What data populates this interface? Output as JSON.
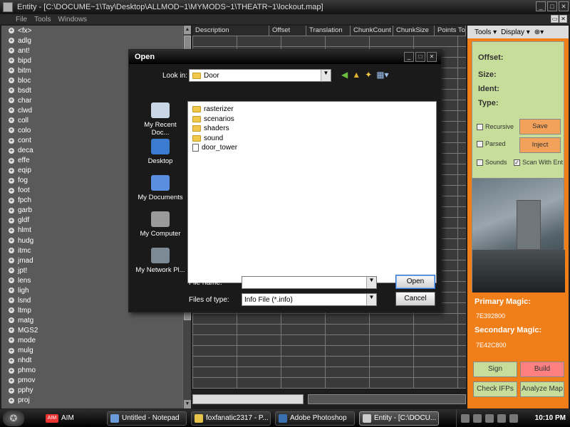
{
  "window": {
    "title": "Entity - [C:\\DOCUME~1\\Tay\\Desktop\\ALLMOD~1\\MYMODS~1\\THEATR~1\\lockout.map]",
    "menu": [
      "File",
      "Tools",
      "Windows"
    ]
  },
  "tree": {
    "items": [
      "<fx>",
      "adlg",
      "ant!",
      "bipd",
      "bitm",
      "bloc",
      "bsdt",
      "char",
      "clwd",
      "coll",
      "colo",
      "cont",
      "deca",
      "effe",
      "eqip",
      "fog",
      "foot",
      "fpch",
      "garb",
      "gldf",
      "hlmt",
      "hudg",
      "itmc",
      "jmad",
      "jpt!",
      "lens",
      "ligh",
      "lsnd",
      "ltmp",
      "matg",
      "MGS2",
      "mode",
      "mulg",
      "nhdt",
      "phmo",
      "pmov",
      "pphy",
      "proj"
    ]
  },
  "grid": {
    "columns": [
      "Description",
      "Offset",
      "Translation",
      "ChunkCount",
      "ChunkSize",
      "Points To"
    ]
  },
  "right_panel": {
    "toolbar": {
      "tools": "Tools",
      "display": "Display"
    },
    "info_labels": {
      "offset": "Offset:",
      "size": "Size:",
      "ident": "Ident:",
      "type": "Type:"
    },
    "checks": {
      "recursive": "Recursive",
      "parsed": "Parsed",
      "sounds": "Sounds",
      "scan_with_ent": "Scan With Ent"
    },
    "buttons": {
      "save": "Save",
      "inject": "Inject",
      "sign": "Sign",
      "build": "Build",
      "check_ifps": "Check IFPs",
      "analyze_map": "Analyze Map"
    },
    "primary_magic_label": "Primary Magic:",
    "primary_magic_value": "7E392800",
    "secondary_magic_label": "Secondary Magic:",
    "secondary_magic_value": "7E42C800"
  },
  "dialog": {
    "title": "Open",
    "look_in_label": "Look in:",
    "look_in_value": "Door",
    "places": [
      "My Recent Doc...",
      "Desktop",
      "My Documents",
      "My Computer",
      "My Network Pl..."
    ],
    "files": [
      {
        "name": "rasterizer",
        "kind": "folder"
      },
      {
        "name": "scenarios",
        "kind": "folder"
      },
      {
        "name": "shaders",
        "kind": "folder"
      },
      {
        "name": "sound",
        "kind": "folder"
      },
      {
        "name": "door_tower",
        "kind": "file"
      }
    ],
    "file_name_label": "File name:",
    "file_name_value": "",
    "files_of_type_label": "Files of type:",
    "files_of_type_value": "Info File (*.info)",
    "open_label": "Open",
    "cancel_label": "Cancel"
  },
  "taskbar": {
    "aim": "AIM",
    "aim_badge": "AIM",
    "buttons": [
      "Untitled - Notepad",
      "foxfanatic2317 - P...",
      "Adobe Photoshop",
      "Entity - [C:\\DOCU..."
    ],
    "clock": "10:10 PM"
  }
}
